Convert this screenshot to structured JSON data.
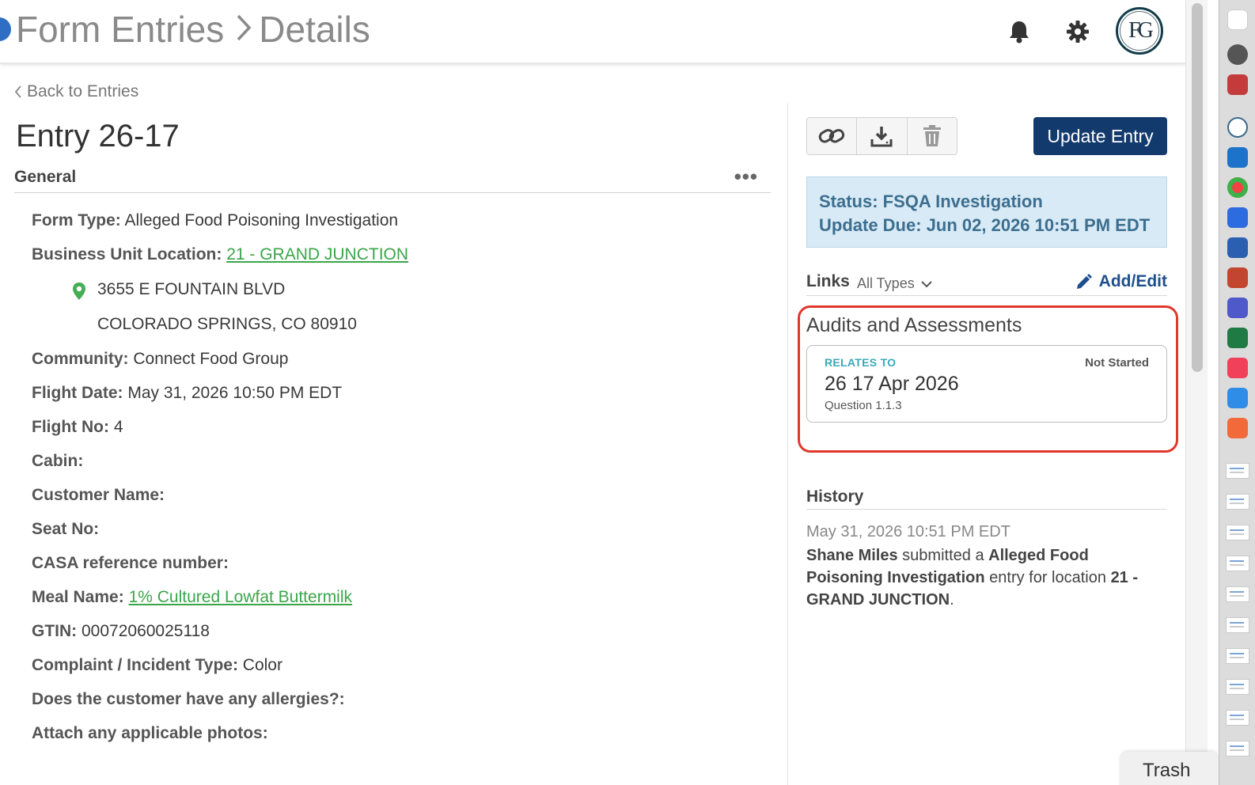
{
  "header": {
    "breadcrumb_root": "Form Entries",
    "breadcrumb_sep": ">",
    "breadcrumb_current": "Details",
    "avatar_initials": "FG"
  },
  "back_link": "Back to Entries",
  "entry_title": "Entry 26-17",
  "general": {
    "title": "General",
    "more_label": "•••",
    "fields": {
      "form_type": {
        "label": "Form Type:",
        "value": "Alleged Food Poisoning Investigation"
      },
      "business_unit": {
        "label": "Business Unit Location:",
        "value": "21 - GRAND JUNCTION"
      },
      "address_line1": "3655 E FOUNTAIN BLVD",
      "address_line2": "COLORADO SPRINGS, CO 80910",
      "community": {
        "label": "Community:",
        "value": "Connect Food Group"
      },
      "flight_date": {
        "label": "Flight Date:",
        "value": "May 31, 2026 10:50 PM EDT"
      },
      "flight_no": {
        "label": "Flight No:",
        "value": "4"
      },
      "cabin": {
        "label": "Cabin:",
        "value": ""
      },
      "customer_name": {
        "label": "Customer Name:",
        "value": ""
      },
      "seat_no": {
        "label": "Seat No:",
        "value": ""
      },
      "casa_ref": {
        "label": "CASA reference number:",
        "value": ""
      },
      "meal_name": {
        "label": "Meal Name:",
        "value": "1% Cultured Lowfat Buttermilk"
      },
      "gtin": {
        "label": "GTIN:",
        "value": "00072060025118"
      },
      "complaint_type": {
        "label": "Complaint / Incident Type:",
        "value": "Color"
      },
      "allergies": {
        "label": "Does the customer have any allergies?:",
        "value": ""
      },
      "photos": {
        "label": "Attach any applicable photos:",
        "value": ""
      }
    }
  },
  "actions": {
    "update_entry": "Update Entry",
    "icons": [
      "link-icon",
      "download-icon",
      "trash-icon"
    ]
  },
  "status_box": {
    "status": "Status: FSQA Investigation",
    "update_due": "Update Due: Jun 02, 2026 10:51 PM EDT"
  },
  "links": {
    "title": "Links",
    "filter": "All Types",
    "add_edit": "Add/Edit"
  },
  "audits": {
    "title": "Audits and Assessments",
    "card": {
      "relates_to": "RELATES TO",
      "status": "Not Started",
      "name": "26 17 Apr 2026",
      "question": "Question 1.1.3"
    }
  },
  "history": {
    "title": "History",
    "timestamp": "May 31, 2026 10:51 PM EDT",
    "user": "Shane Miles",
    "action": "submitted a",
    "form": "Alleged Food Poisoning Investigation",
    "middle": "entry for location",
    "location": "21 - GRAND JUNCTION",
    "end": "."
  },
  "trash_tab": "Trash",
  "colors": {
    "primary": "#133a6c",
    "link_green": "#3aa64a",
    "status_bg": "#d8eaf5",
    "highlight": "#e0382c"
  }
}
